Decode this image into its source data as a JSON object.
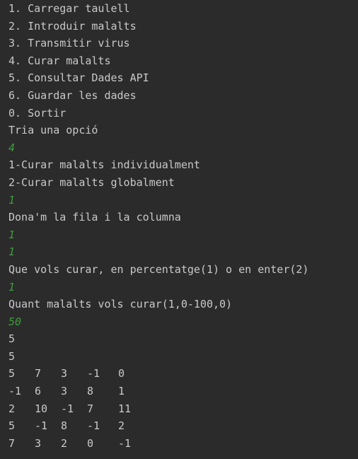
{
  "console": {
    "lines": [
      {
        "type": "out",
        "text": "1. Carregar taulell"
      },
      {
        "type": "out",
        "text": "2. Introduir malalts"
      },
      {
        "type": "out",
        "text": "3. Transmitir virus"
      },
      {
        "type": "out",
        "text": "4. Curar malalts"
      },
      {
        "type": "out",
        "text": "5. Consultar Dades API"
      },
      {
        "type": "out",
        "text": "6. Guardar les dades"
      },
      {
        "type": "out",
        "text": "0. Sortir"
      },
      {
        "type": "out",
        "text": "Tria una opció"
      },
      {
        "type": "in",
        "text": "4"
      },
      {
        "type": "out",
        "text": "1-Curar malalts individualment"
      },
      {
        "type": "out",
        "text": "2-Curar malalts globalment"
      },
      {
        "type": "in",
        "text": "1"
      },
      {
        "type": "out",
        "text": "Dona'm la fila i la columna"
      },
      {
        "type": "in",
        "text": "1"
      },
      {
        "type": "in",
        "text": "1"
      },
      {
        "type": "out",
        "text": "Que vols curar, en percentatge(1) o en enter(2)"
      },
      {
        "type": "in",
        "text": "1"
      },
      {
        "type": "out",
        "text": "Quant malalts vols curar(1,0-100,0)"
      },
      {
        "type": "in",
        "text": "50"
      },
      {
        "type": "out",
        "text": "5"
      },
      {
        "type": "out",
        "text": "5"
      }
    ],
    "grid": [
      [
        "5",
        "7",
        "3",
        "-1",
        "0"
      ],
      [
        "-1",
        "6",
        "3",
        "8",
        "1"
      ],
      [
        "2",
        "10",
        "-1",
        "7",
        "11"
      ],
      [
        "5",
        "-1",
        "8",
        "-1",
        "2"
      ],
      [
        "7",
        "3",
        "2",
        "0",
        "-1"
      ]
    ]
  },
  "colors": {
    "background": "#2b2b2b",
    "output_text": "#c9c9c9",
    "input_text": "#3f9b3f"
  }
}
